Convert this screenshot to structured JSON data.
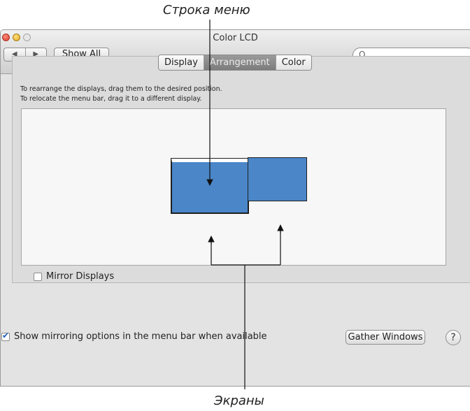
{
  "annotations": {
    "menu_bar": "Строка меню",
    "displays": "Экраны"
  },
  "window": {
    "title": "Color LCD",
    "back_glyph": "◀",
    "forward_glyph": "▶",
    "show_all": "Show All",
    "search_placeholder": "",
    "search_icon_glyph": "Q"
  },
  "tabs": [
    {
      "label": "Display",
      "active": false
    },
    {
      "label": "Arrangement",
      "active": true
    },
    {
      "label": "Color",
      "active": false
    }
  ],
  "instructions": {
    "line1": "To rearrange the displays, drag them to the desired position.",
    "line2": "To relocate the menu bar, drag it to a different display."
  },
  "displays_colors": {
    "fill": "#4a86c8",
    "menu_bar": "#ffffff"
  },
  "mirror_displays": {
    "label": "Mirror Displays",
    "checked": false
  },
  "show_mirroring": {
    "label": "Show mirroring options in the menu bar when available",
    "checked": true
  },
  "buttons": {
    "gather_windows": "Gather Windows",
    "help": "?"
  }
}
